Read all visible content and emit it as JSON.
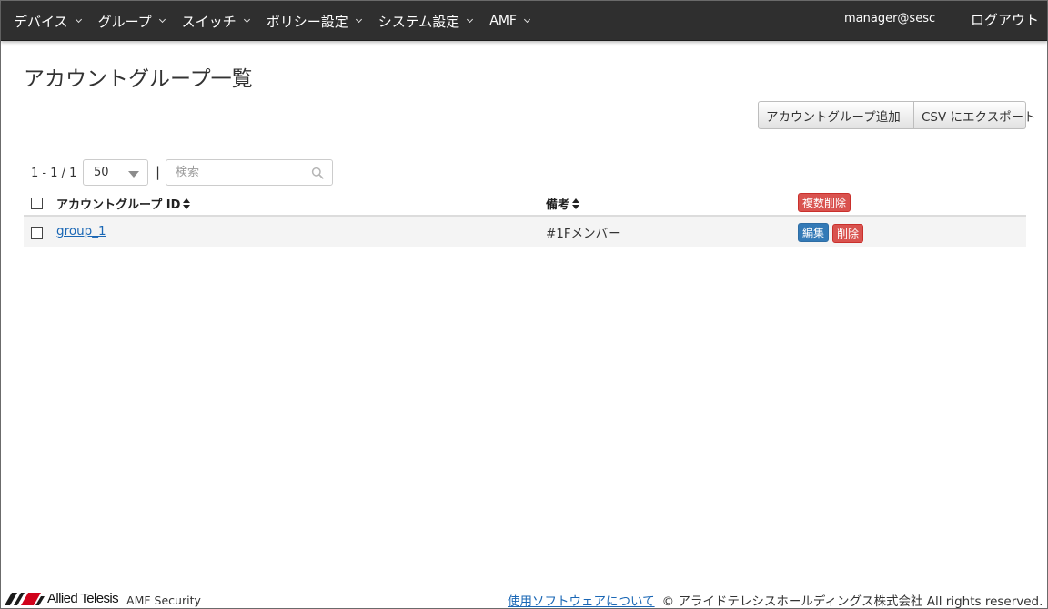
{
  "navbar": {
    "menu": [
      {
        "label": "デバイス"
      },
      {
        "label": "グループ"
      },
      {
        "label": "スイッチ"
      },
      {
        "label": "ポリシー設定"
      },
      {
        "label": "システム設定"
      },
      {
        "label": "AMF"
      }
    ],
    "user": "manager@sesc",
    "logout": "ログアウト"
  },
  "page": {
    "title": "アカウントグループ一覧",
    "add_button": "アカウントグループ追加",
    "export_button": "CSV にエクスポート"
  },
  "pager": {
    "count": "1 - 1 / 1",
    "per_page": "50",
    "separator": "|",
    "search_placeholder": "検索"
  },
  "table": {
    "headers": {
      "id": "アカウントグループ ID",
      "note": "備考",
      "bulk_delete": "複数削除"
    },
    "rows": [
      {
        "id": "group_1",
        "note": "#1Fメンバー",
        "edit": "編集",
        "delete": "削除"
      }
    ]
  },
  "footer": {
    "brand": "Allied Telesis",
    "product": "AMF Security",
    "about_link": "使用ソフトウェアについて",
    "copyright": "© アライドテレシスホールディングス株式会社 All rights reserved."
  },
  "colors": {
    "navbar_bg": "#2f2f2f",
    "link": "#1a67b5",
    "danger": "#d9534f",
    "primary": "#337ab7"
  },
  "icons": {
    "search": "search-icon",
    "caret": "chevron-down-icon",
    "sort": "sort-icon",
    "logo": "allied-telesis-logo"
  }
}
